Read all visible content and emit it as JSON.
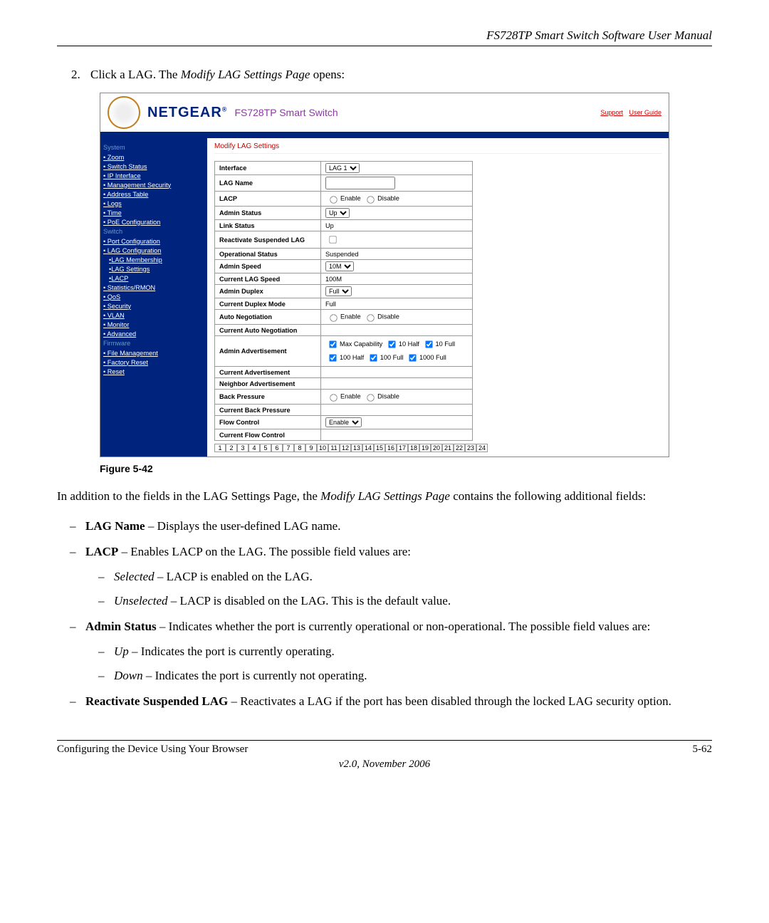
{
  "doc": {
    "header": "FS728TP Smart Switch Software User Manual",
    "instruction_num": "2.",
    "instruction_pre": "Click a LAG. The ",
    "instruction_em": "Modify LAG Settings Page",
    "instruction_post": " opens:",
    "fig_caption": "Figure 5-42",
    "intro_pre": "In addition to the fields in the LAG Settings Page, the ",
    "intro_em": "Modify LAG Settings Page",
    "intro_post": " contains the following additional fields:",
    "footer_left": "Configuring the Device Using Your Browser",
    "footer_right": "5-62",
    "footer_center": "v2.0, November 2006"
  },
  "fields": {
    "f1_label": "LAG Name",
    "f1_desc": " – Displays the user-defined LAG name.",
    "f2_label": "LACP",
    "f2_desc": " – Enables LACP on the LAG. The possible field values are:",
    "f2a_label": "Selected",
    "f2a_desc": " – LACP is enabled on the LAG.",
    "f2b_label": "Unselected",
    "f2b_desc": " – LACP is disabled on the LAG. This is the default value.",
    "f3_label": "Admin Status",
    "f3_desc": " – Indicates whether the port is currently operational or non-operational. The possible field values are:",
    "f3a_label": "Up",
    "f3a_desc": " – Indicates the port is currently operating.",
    "f3b_label": "Down",
    "f3b_desc": " – Indicates the port is currently not operating.",
    "f4_label": "Reactivate Suspended LAG",
    "f4_desc": " – Reactivates a LAG if the port has been disabled through the locked LAG security option."
  },
  "scr": {
    "brand": "NETGEAR",
    "product": "FS728TP Smart Switch",
    "link_support": "Support",
    "link_guide": "User Guide",
    "page_title": "Modify LAG Settings",
    "side": {
      "sect_system": "System",
      "zoom": "Zoom",
      "switch_status": "Switch Status",
      "ip_interface": "IP Interface",
      "mgmt_security": "Management Security",
      "address_table": "Address Table",
      "logs": "Logs",
      "time": "Time",
      "poe": "PoE Configuration",
      "sect_switch": "Switch",
      "port_config": "Port Configuration",
      "lag_config": "LAG Configuration",
      "lag_membership": "LAG Membership",
      "lag_settings": "LAG Settings",
      "lacp": "LACP",
      "stats": "Statistics/RMON",
      "qos": "QoS",
      "security": "Security",
      "vlan": "VLAN",
      "monitor": "Monitor",
      "advanced": "Advanced",
      "sect_firmware": "Firmware",
      "file_mgmt": "File Management",
      "factory_reset": "Factory Reset",
      "reset": "Reset"
    },
    "rows": {
      "interface": "Interface",
      "interface_val": "LAG 1",
      "lag_name": "LAG Name",
      "lacp": "LACP",
      "enable": "Enable",
      "disable": "Disable",
      "admin_status": "Admin Status",
      "admin_status_val": "Up",
      "link_status": "Link Status",
      "link_status_val": "Up",
      "react_susp": "Reactivate Suspended LAG",
      "op_status": "Operational Status",
      "op_status_val": "Suspended",
      "admin_speed": "Admin Speed",
      "admin_speed_val": "10M",
      "cur_lag_speed": "Current LAG Speed",
      "cur_lag_speed_val": "100M",
      "admin_duplex": "Admin Duplex",
      "admin_duplex_val": "Full",
      "cur_duplex": "Current Duplex Mode",
      "cur_duplex_val": "Full",
      "auto_neg": "Auto Negotiation",
      "cur_auto_neg": "Current Auto Negotiation",
      "admin_adv": "Admin Advertisement",
      "adv_maxcap": "Max Capability",
      "adv_10h": "10 Half",
      "adv_10f": "10 Full",
      "adv_100h": "100 Half",
      "adv_100f": "100 Full",
      "adv_1000f": "1000 Full",
      "cur_adv": "Current Advertisement",
      "neigh_adv": "Neighbor Advertisement",
      "back_press": "Back Pressure",
      "cur_back_press": "Current Back Pressure",
      "flow_ctrl": "Flow Control",
      "flow_ctrl_val": "Enable",
      "cur_flow_ctrl": "Current Flow Control"
    },
    "ports": [
      "1",
      "2",
      "3",
      "4",
      "5",
      "6",
      "7",
      "8",
      "9",
      "10",
      "11",
      "12",
      "13",
      "14",
      "15",
      "16",
      "17",
      "18",
      "19",
      "20",
      "21",
      "22",
      "23",
      "24"
    ]
  }
}
